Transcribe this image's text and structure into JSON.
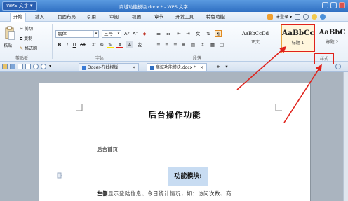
{
  "app": {
    "logo": "WPS 文字 ▾",
    "doc_title": "商城功能模块.docx * - WPS 文字"
  },
  "menu": {
    "items": [
      "开始",
      "插入",
      "页面布局",
      "引用",
      "审阅",
      "视图",
      "章节",
      "开发工具",
      "特色功能"
    ],
    "right_label": "未登录 ▾"
  },
  "ribbon": {
    "clipboard": {
      "paste": "粘贴",
      "cut": "剪切",
      "copy": "复制",
      "format_painter": "格式刷",
      "label": "剪贴板"
    },
    "font": {
      "name": "黑体",
      "size": "三号",
      "label": "字体"
    },
    "paragraph": {
      "label": "段落"
    },
    "styles": {
      "items": [
        {
          "sample": "AaBbCcDd",
          "caption": "正文"
        },
        {
          "sample": "AaBbCc",
          "caption": "标题 1"
        },
        {
          "sample": "AaBbC",
          "caption": "标题 2"
        }
      ],
      "label": "样式"
    }
  },
  "tabs": [
    {
      "label": "Docer-在线模板"
    },
    {
      "label": "商城功能模块.docx *"
    }
  ],
  "document": {
    "heading": "后台操作功能",
    "para1": "后台首页",
    "h2": "功能模块:",
    "para2_bold": "左侧",
    "para2_rest": "显示登陆信息、今日统计情况，如：访问次数、商"
  },
  "colors": {
    "title_bar": "#3a7bd5",
    "annotation": "#e0221b"
  }
}
